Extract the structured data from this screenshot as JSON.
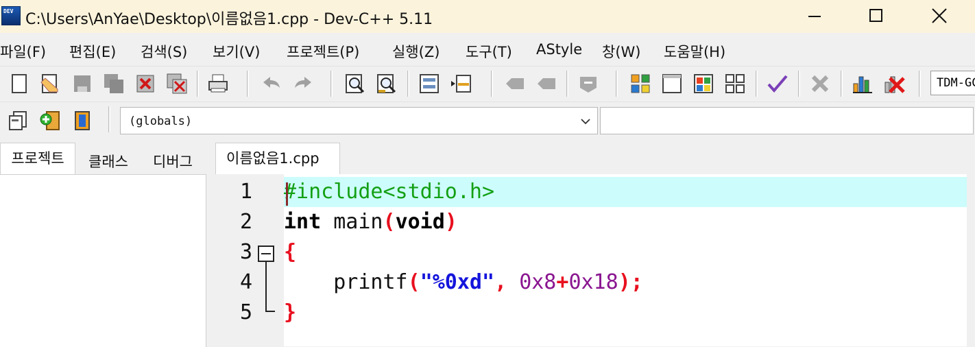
{
  "window": {
    "icon_text": "DEV",
    "title": "C:\\Users\\AnYae\\Desktop\\이름없음1.cpp - Dev-C++ 5.11",
    "controls": [
      "minimize-icon",
      "maximize-icon",
      "close-icon"
    ]
  },
  "menu": {
    "items": [
      "파일(F)",
      "편집(E)",
      "검색(S)",
      "보기(V)",
      "프로젝트(P)",
      "실행(Z)",
      "도구(T)",
      "AStyle",
      "창(W)",
      "도움말(H)"
    ]
  },
  "toolbar": {
    "compiler_value": "TDM-GCC",
    "icons": [
      "new-file-icon",
      "open-file-icon",
      "save-icon",
      "save-all-icon",
      "close-file-icon",
      "close-all-icon",
      "print-icon",
      "undo-icon",
      "redo-icon",
      "find-icon",
      "replace-icon",
      "indent-icon",
      "unindent-icon",
      "toggle-bookmark-icon",
      "goto-bookmark-icon",
      "comment-icon",
      "compile-icon",
      "run-icon",
      "compile-run-icon",
      "rebuild-icon",
      "syntax-check-icon",
      "delete-icon",
      "profile-icon",
      "stop-icon"
    ]
  },
  "toolbar2": {
    "class_value": "(globals)",
    "member_value": ""
  },
  "left_panel": {
    "tabs": [
      "프로젝트",
      "클래스",
      "디버그"
    ],
    "active_tab": "프로젝트"
  },
  "editor": {
    "tab_label": "이름없음1.cpp",
    "line_numbers": [
      "1",
      "2",
      "3",
      "4",
      "5"
    ],
    "code": {
      "l1": "#include<stdio.h>",
      "l2_kw1": "int",
      "l2_name": " main",
      "l2_open": "(",
      "l2_kw2": "void",
      "l2_close": ")",
      "l3": "{",
      "l4_indent": "    ",
      "l4_func": "printf",
      "l4_open": "(",
      "l4_str": "\"%0xd\"",
      "l4_comma": ",",
      "l4_sp": " ",
      "l4_n1": "0x8",
      "l4_plus": "+",
      "l4_n2": "0x18",
      "l4_close": ");",
      "l5": "}"
    },
    "colors": {
      "current_line": "#ccfcfc",
      "preprocessor": "#14a014",
      "symbol": "#e8101f",
      "string": "#1414dc",
      "number": "#8a1590"
    }
  }
}
